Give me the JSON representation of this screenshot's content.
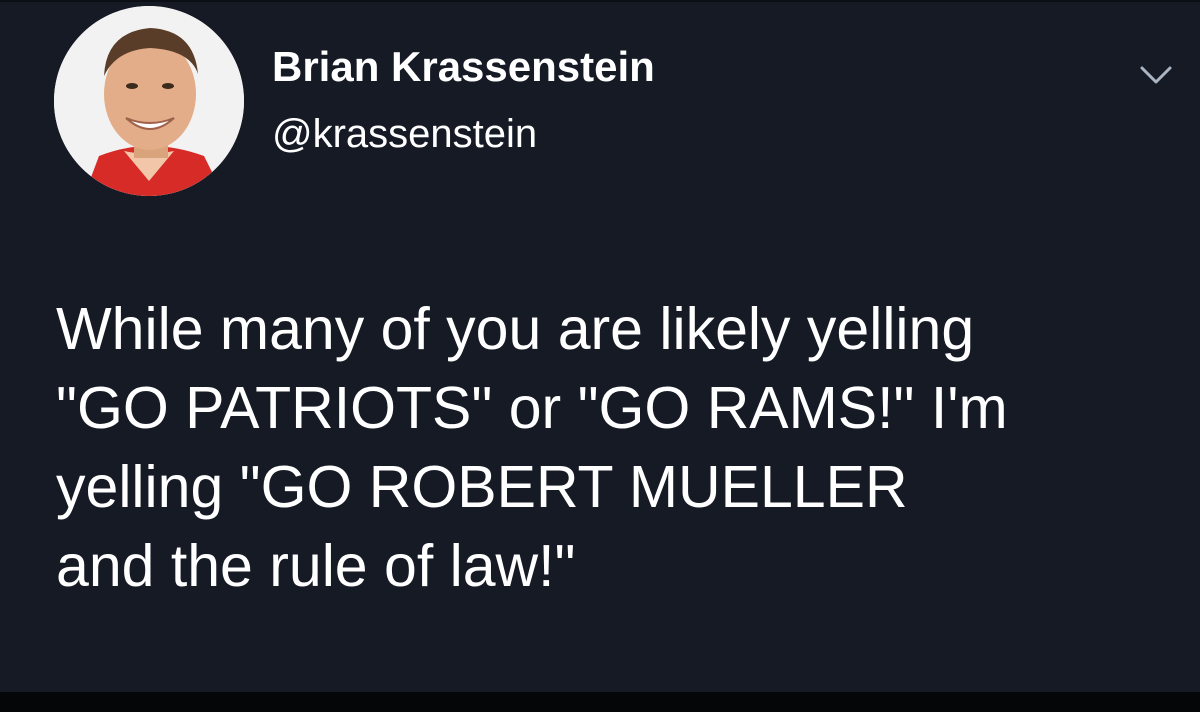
{
  "tweet": {
    "author": {
      "display_name": "Brian Krassenstein",
      "handle": "@krassenstein",
      "avatar_icon": "profile-photo"
    },
    "menu_icon": "chevron-down-icon",
    "text_lines": [
      "While many of you are likely yelling",
      "\"GO PATRIOTS\" or \"GO RAMS!\" I'm",
      "yelling \"GO ROBERT MUELLER",
      "and the rule of law!\""
    ]
  },
  "colors": {
    "background": "#151a25",
    "text": "#ffffff",
    "caret": "#aab4c2"
  }
}
